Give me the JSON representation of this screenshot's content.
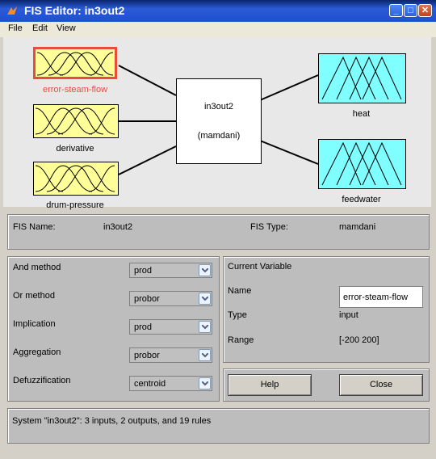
{
  "window": {
    "title": "FIS Editor: in3out2",
    "min_label": "_",
    "max_label": "□",
    "close_label": "✕"
  },
  "menu": [
    "File",
    "Edit",
    "View"
  ],
  "diagram": {
    "inputs": [
      "error-steam-flow",
      "derivative",
      "drum-pressure"
    ],
    "outputs": [
      "heat",
      "feedwater"
    ],
    "system_name": "in3out2",
    "system_type_display": "(mamdani)"
  },
  "fis_info": {
    "name_label": "FIS Name:",
    "name_value": "in3out2",
    "type_label": "FIS Type:",
    "type_value": "mamdani"
  },
  "methods": [
    {
      "label": "And method",
      "value": "prod"
    },
    {
      "label": "Or method",
      "value": "probor"
    },
    {
      "label": "Implication",
      "value": "prod"
    },
    {
      "label": "Aggregation",
      "value": "probor"
    },
    {
      "label": "Defuzzification",
      "value": "centroid"
    }
  ],
  "current_variable": {
    "heading": "Current Variable",
    "name_label": "Name",
    "name_value": "error-steam-flow",
    "type_label": "Type",
    "type_value": "input",
    "range_label": "Range",
    "range_value": "[-200 200]"
  },
  "buttons": {
    "help": "Help",
    "close": "Close"
  },
  "status": "System \"in3out2\": 3 inputs, 2 outputs, and 19 rules",
  "colors": {
    "input_box": "#ffff99",
    "output_box": "#7fffff",
    "selected_border": "#e84c3d",
    "selected_label": "#e84c3d"
  }
}
